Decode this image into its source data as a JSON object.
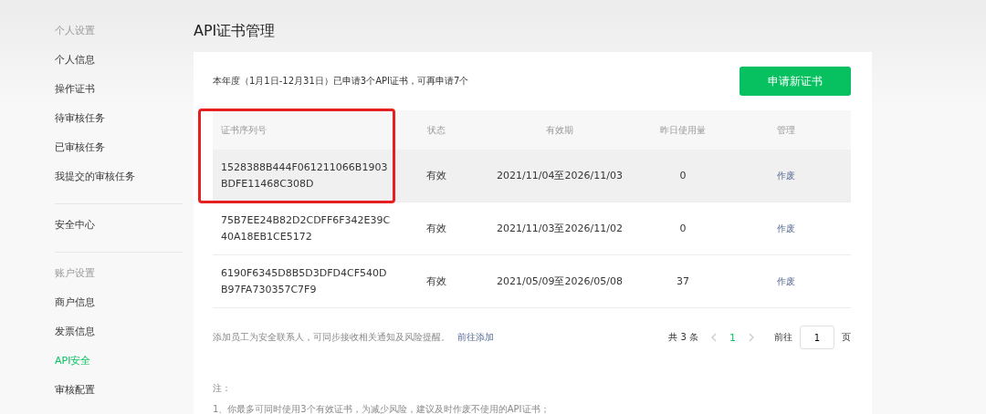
{
  "sidebar": {
    "groups": [
      {
        "heading": "个人设置",
        "items": [
          {
            "label": "个人信息",
            "selected": false
          },
          {
            "label": "操作证书",
            "selected": false
          },
          {
            "label": "待审核任务",
            "selected": false
          },
          {
            "label": "已审核任务",
            "selected": false
          },
          {
            "label": "我提交的审核任务",
            "selected": false
          }
        ]
      },
      {
        "items": [
          {
            "label": "安全中心",
            "selected": false
          }
        ]
      },
      {
        "heading": "账户设置",
        "items": [
          {
            "label": "商户信息",
            "selected": false
          },
          {
            "label": "发票信息",
            "selected": false
          },
          {
            "label": "API安全",
            "selected": true
          },
          {
            "label": "审核配置",
            "selected": false
          }
        ]
      }
    ]
  },
  "page_title": "API证书管理",
  "summary": "本年度（1月1日-12月31日）已申请3个API证书，可再申请7个",
  "apply_button": "申请新证书",
  "table": {
    "annotation_box": true,
    "columns": [
      "证书序列号",
      "状态",
      "有效期",
      "昨日使用量",
      "管理"
    ],
    "rows": [
      {
        "serial": "1528388B444F061211066B1903 BDFE11468C308D",
        "status": "有效",
        "validity": "2021/11/04至2026/11/03",
        "usage": "0",
        "action": "作废",
        "highlighted": true
      },
      {
        "serial": "75B7EE24B82D2CDFF6F342E39C 40A18EB1CE5172",
        "status": "有效",
        "validity": "2021/11/03至2026/11/02",
        "usage": "0",
        "action": "作废",
        "highlighted": false
      },
      {
        "serial": "6190F6345D8B5D3DFD4CF540D B97FA730357C7F9",
        "status": "有效",
        "validity": "2021/05/09至2026/05/08",
        "usage": "37",
        "action": "作废",
        "highlighted": false
      }
    ]
  },
  "footer": {
    "text": "添加员工为安全联系人，可同步接收相关通知及风险提醒。",
    "link": "前往添加"
  },
  "pagination": {
    "total": "共 3 条",
    "pages": [
      {
        "label": "1",
        "selected": true
      }
    ],
    "goto_label": "前往",
    "goto_value": "1",
    "goto_suffix": "页"
  },
  "notes": {
    "heading": "注：",
    "lines": [
      "1、你最多可同时使用3个有效证书，为减少风险，建议及时作废不使用的API证书；"
    ]
  }
}
